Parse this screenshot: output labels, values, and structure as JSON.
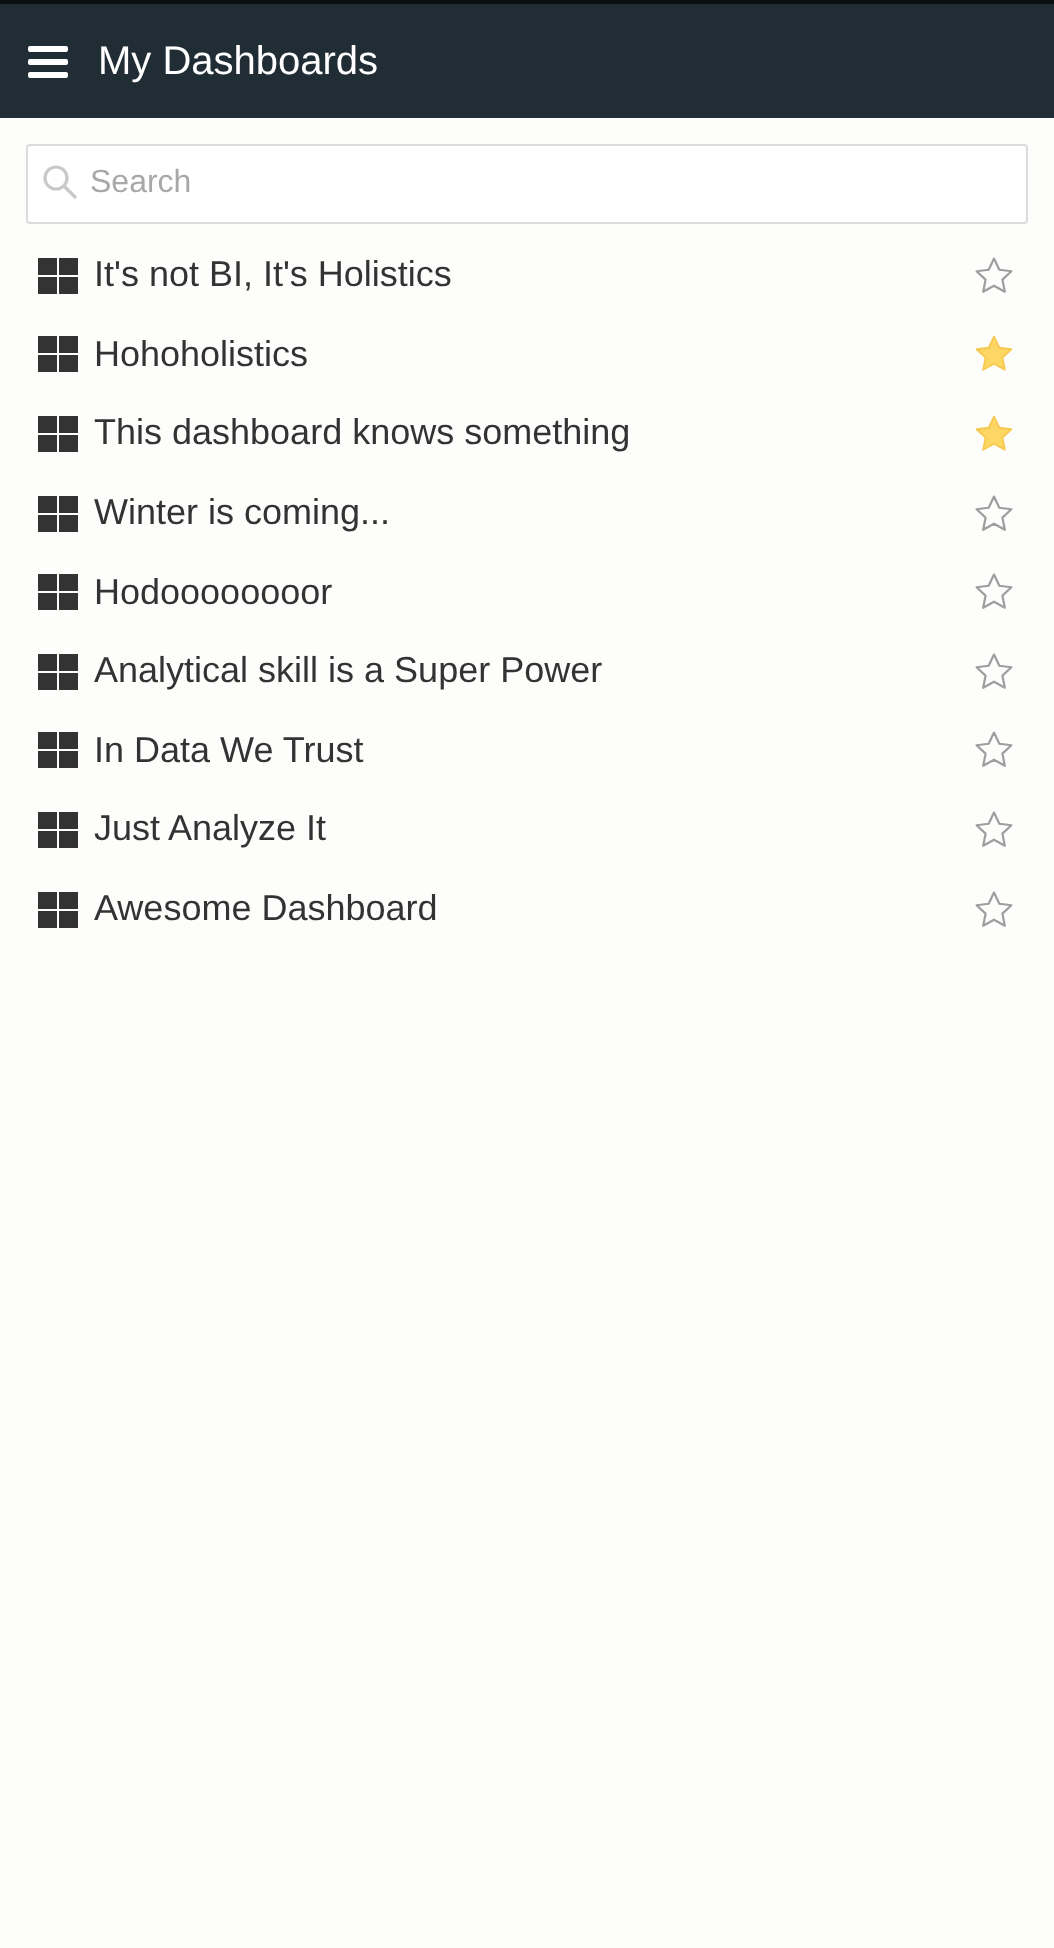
{
  "header": {
    "title": "My Dashboards"
  },
  "search": {
    "placeholder": "Search"
  },
  "dashboards": [
    {
      "name": "It's not BI, It's Holistics",
      "starred": false
    },
    {
      "name": "Hohoholistics",
      "starred": true
    },
    {
      "name": "This dashboard knows something",
      "starred": true
    },
    {
      "name": "Winter is coming...",
      "starred": false
    },
    {
      "name": "Hodoooooooor",
      "starred": false
    },
    {
      "name": "Analytical skill is a Super Power",
      "starred": false
    },
    {
      "name": "In Data We Trust",
      "starred": false
    },
    {
      "name": "Just Analyze It",
      "starred": false
    },
    {
      "name": "Awesome Dashboard",
      "starred": false
    }
  ]
}
